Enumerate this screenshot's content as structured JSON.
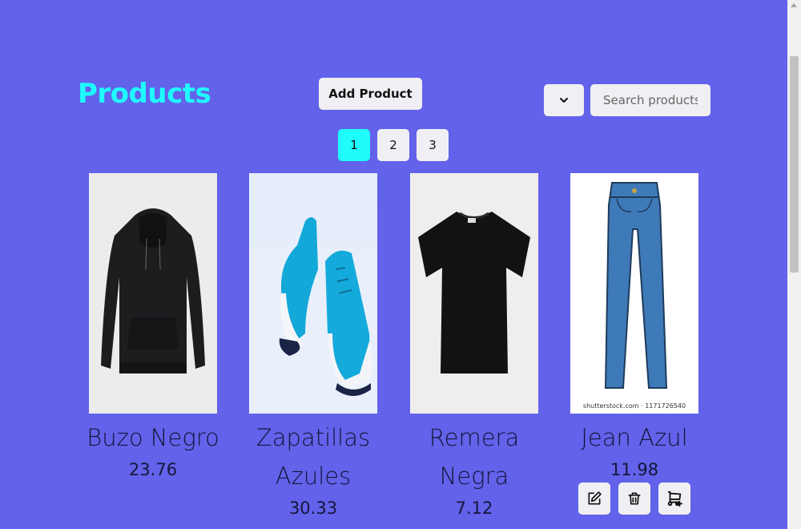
{
  "header": {
    "title": "Products",
    "add_label": "Add Product",
    "search_placeholder": "Search products"
  },
  "pagination": {
    "pages": [
      "1",
      "2",
      "3"
    ],
    "active": "1"
  },
  "products": [
    {
      "name": "Buzo Negro",
      "price": "23.76",
      "image": "black-hoodie"
    },
    {
      "name": "Zapatillas Azules",
      "price": "30.33",
      "image": "blue-sneakers"
    },
    {
      "name": "Remera Negra",
      "price": "7.12",
      "image": "black-tshirt"
    },
    {
      "name": "Jean Azul",
      "price": "11.98",
      "image": "blue-jeans",
      "watermark": "shutterstock.com · 1171726540"
    }
  ],
  "icons": {
    "edit": "pencil-square-icon",
    "delete": "trash-icon",
    "cart": "cart-plus-icon",
    "sort": "chevron-down-icon"
  },
  "colors": {
    "background": "#6262ea",
    "title": "#1efcfc",
    "active_page": "#1efcfc",
    "button": "#f0f0f4"
  }
}
